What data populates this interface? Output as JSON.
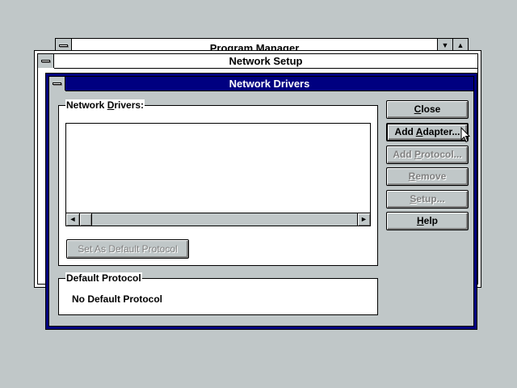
{
  "program_manager": {
    "title": "Program Manager",
    "minimize_glyph": "▼",
    "maximize_glyph": "▲"
  },
  "network_setup": {
    "title": "Network Setup"
  },
  "network_drivers_dialog": {
    "title": "Network Drivers",
    "drivers_group_label_pre": "Network ",
    "drivers_group_label_key": "D",
    "drivers_group_label_post": "rivers:",
    "drivers_list": [],
    "scroll_left_glyph": "◄",
    "scroll_right_glyph": "►",
    "set_default_label": "Set As Default Protocol",
    "default_protocol_label": "Default Protocol",
    "default_protocol_value": "No Default Protocol",
    "buttons": {
      "close": {
        "key": "C",
        "rest": "lose"
      },
      "add_adapter": {
        "key": "A",
        "pre": "Add ",
        "rest": "dapter..."
      },
      "add_protocol": {
        "key": "P",
        "pre": "Add ",
        "rest": "rotocol..."
      },
      "remove": {
        "key": "R",
        "rest": "emove"
      },
      "setup": {
        "key": "S",
        "rest": "etup..."
      },
      "help": {
        "key": "H",
        "rest": "elp"
      }
    }
  },
  "colors": {
    "desktop": "#c0c7c8",
    "active_title": "#000080",
    "disabled_text": "#808080"
  },
  "icons": {
    "cursor": "arrow-pointer"
  }
}
